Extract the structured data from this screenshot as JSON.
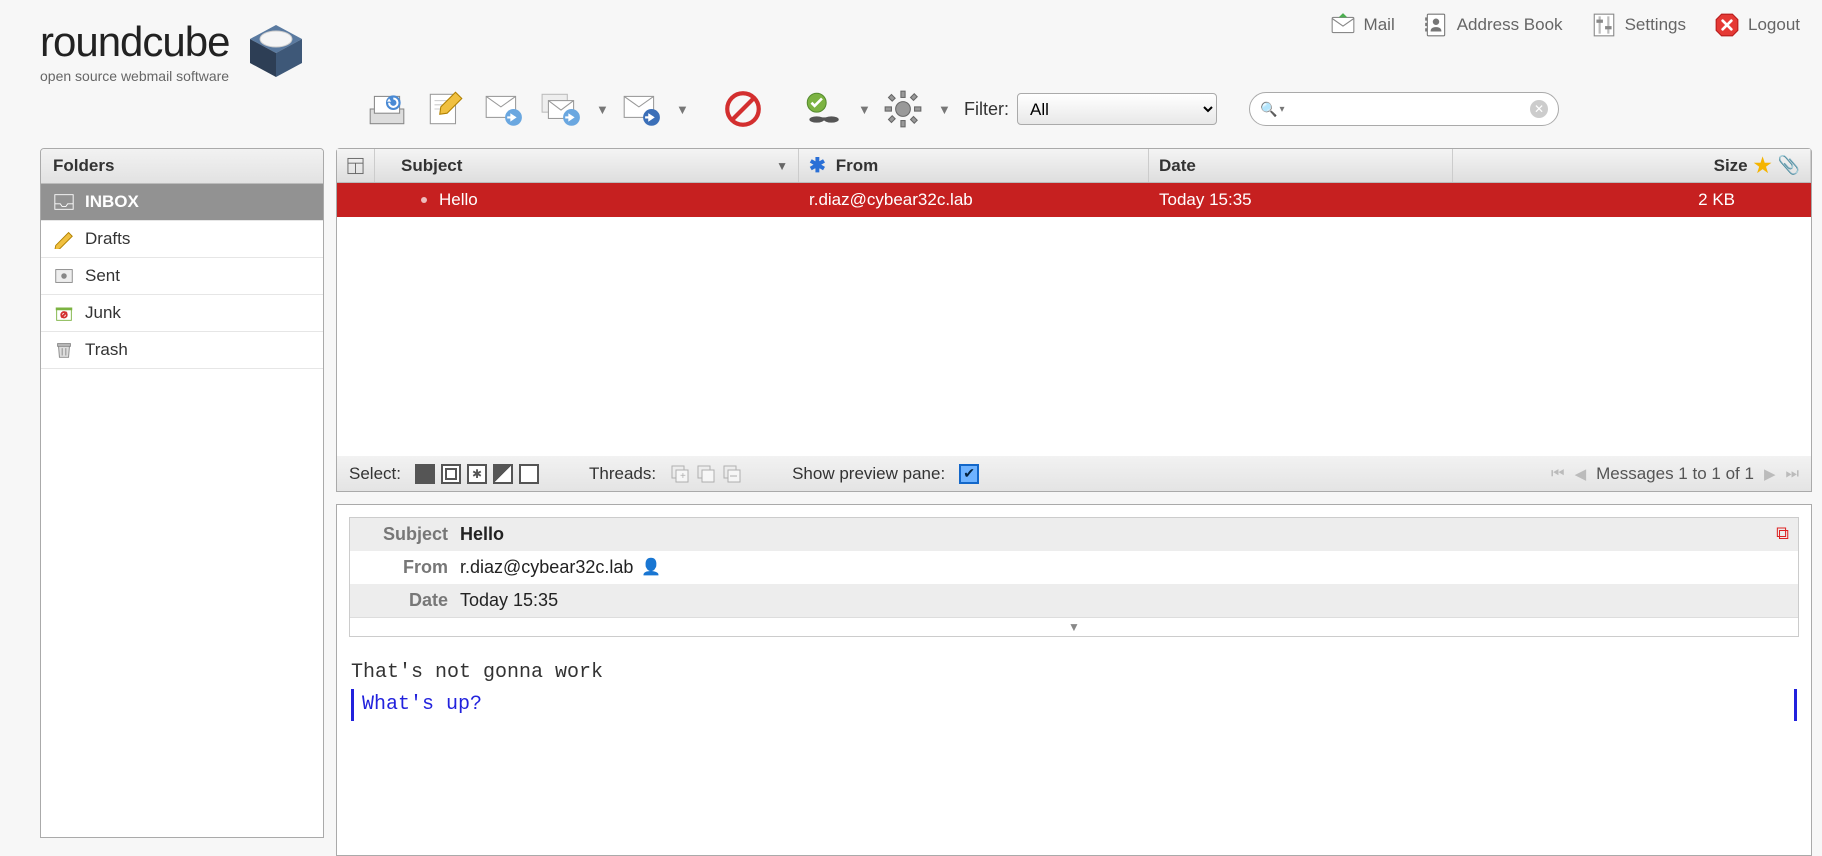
{
  "brand": {
    "name": "roundcube",
    "tagline": "open source webmail software"
  },
  "topnav": {
    "mail": "Mail",
    "addressbook": "Address Book",
    "settings": "Settings",
    "logout": "Logout"
  },
  "toolbar": {
    "filter_label": "Filter:",
    "filter_value": "All",
    "search_placeholder": ""
  },
  "folders": {
    "header": "Folders",
    "items": [
      {
        "label": "INBOX",
        "selected": true
      },
      {
        "label": "Drafts",
        "selected": false
      },
      {
        "label": "Sent",
        "selected": false
      },
      {
        "label": "Junk",
        "selected": false
      },
      {
        "label": "Trash",
        "selected": false
      }
    ]
  },
  "columns": {
    "subject": "Subject",
    "from": "From",
    "date": "Date",
    "size": "Size"
  },
  "messages": [
    {
      "subject": "Hello",
      "from": "r.diaz@cybear32c.lab",
      "date": "Today 15:35",
      "size": "2 KB",
      "selected": true
    }
  ],
  "listbar": {
    "select_label": "Select:",
    "threads_label": "Threads:",
    "preview_label": "Show preview pane:",
    "pager_text": "Messages 1 to 1 of 1"
  },
  "preview": {
    "subject_label": "Subject",
    "subject_value": "Hello",
    "from_label": "From",
    "from_value": "r.diaz@cybear32c.lab",
    "date_label": "Date",
    "date_value": "Today 15:35",
    "body_line1": "That's not gonna work",
    "body_quote": "What's up?"
  }
}
